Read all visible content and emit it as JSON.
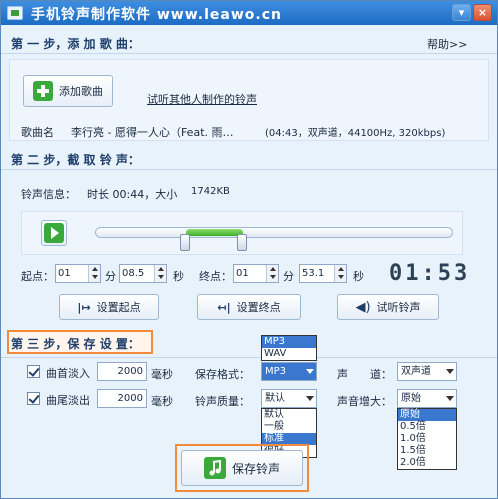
{
  "title": "手机铃声制作软件 www.leawo.cn",
  "window": {
    "min": "▾",
    "close": "×"
  },
  "step1": {
    "title": "第 一 步，添 加 歌 曲：",
    "help": "帮助>>",
    "add_button": "添加歌曲",
    "try_link": "试听其他人制作的铃声"
  },
  "song": {
    "label": "歌曲名",
    "name": "李行亮 - 愿得一人心（Feat. 雨…",
    "info": "(04:43，双声道，44100Hz, 320kbps)"
  },
  "step2": {
    "title": "第 二 步，截 取 铃 声：",
    "info_label": "铃声信息：",
    "duration": "时长 00:44，大小",
    "size": "1742KB"
  },
  "range": {
    "start_label": "起点：",
    "start_min": "01",
    "min_unit": "分",
    "start_sec": "08.5",
    "sec_unit": "秒",
    "end_label": "终点：",
    "end_min": "01",
    "end_sec": "53.1",
    "timer": "01:53",
    "slider_start": 0.25,
    "slider_end": 0.41
  },
  "buttons": {
    "set_start": "设置起点",
    "set_end": "设置终点",
    "listen": "试听铃声",
    "save": "保存铃声"
  },
  "step3": {
    "title": "第 三 步，保 存 设 置：",
    "fadein_label": "曲首淡入",
    "fadein_value": "2000",
    "fadeout_label": "曲尾淡出",
    "fadeout_value": "2000",
    "ms_unit": "毫秒",
    "format_label": "保存格式：",
    "format_value": "MP3",
    "format_options": [
      "MP3",
      "WAV"
    ],
    "channel_label": "声　　道：",
    "channel_value": "双声道",
    "quality_label": "铃声质量：",
    "quality_value": "默认",
    "quality_options": [
      "默认",
      "一般",
      "标准",
      "很好"
    ],
    "gain_label": "声音增大：",
    "gain_value": "原始",
    "gain_options": [
      "原始",
      "0.5倍",
      "1.0倍",
      "1.5倍",
      "2.0倍"
    ]
  },
  "colors": {
    "accent_orange": "#f08c3c",
    "slider_green": "#55c13a",
    "title_blue": "#1d6cc4"
  }
}
